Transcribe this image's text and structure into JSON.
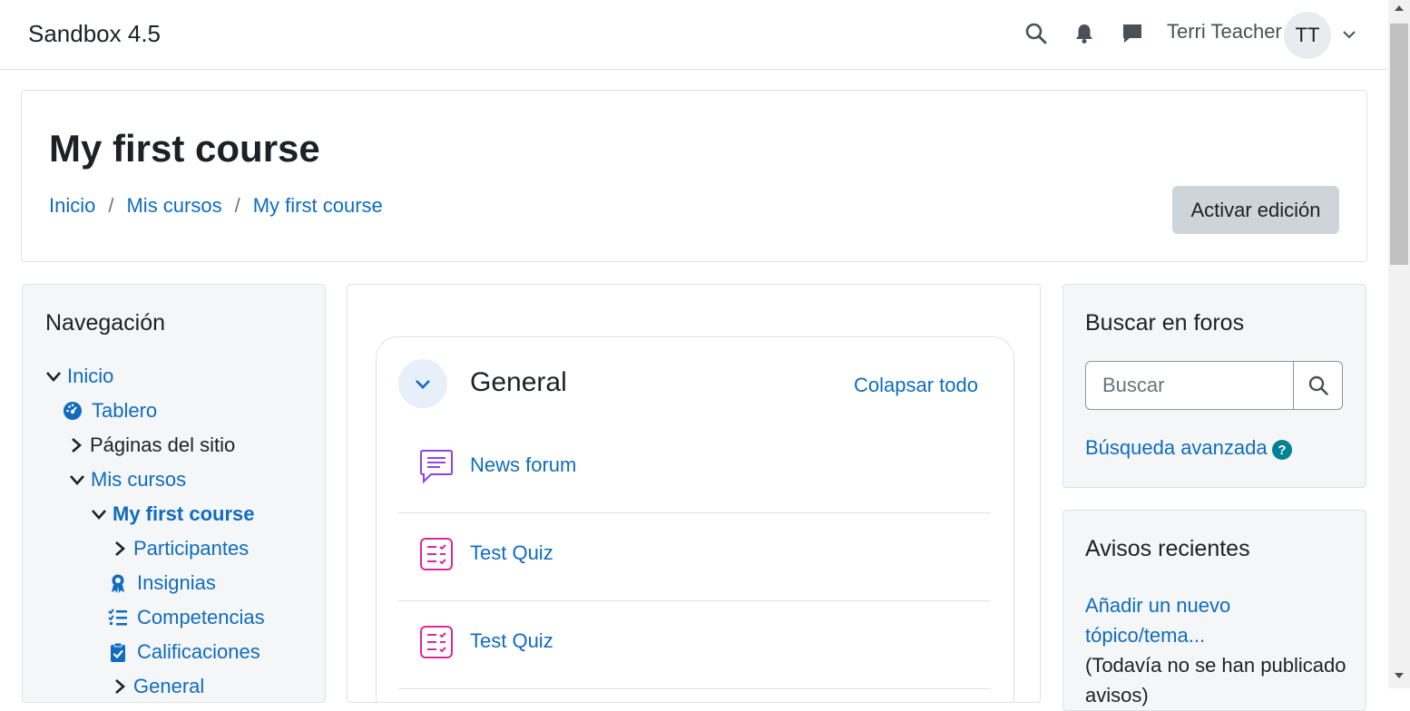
{
  "navbar": {
    "brand": "Sandbox 4.5",
    "user_name": "Terri Teacher",
    "avatar_initials": "TT"
  },
  "header": {
    "title": "My first course",
    "breadcrumb": [
      "Inicio",
      "Mis cursos",
      "My first course"
    ],
    "separator": "/",
    "edit_button": "Activar edición"
  },
  "navigation": {
    "title": "Navegación",
    "items": [
      {
        "label": "Inicio"
      },
      {
        "label": "Tablero"
      },
      {
        "label": "Páginas del sitio"
      },
      {
        "label": "Mis cursos"
      },
      {
        "label": "My first course"
      },
      {
        "label": "Participantes"
      },
      {
        "label": "Insignias"
      },
      {
        "label": "Competencias"
      },
      {
        "label": "Calificaciones"
      },
      {
        "label": "General"
      }
    ]
  },
  "course": {
    "section_name": "General",
    "collapse_all": "Colapsar todo",
    "activities": [
      {
        "name": "News forum",
        "icon": "forum-icon"
      },
      {
        "name": "Test Quiz",
        "icon": "quiz-icon"
      },
      {
        "name": "Test Quiz",
        "icon": "quiz-icon"
      }
    ]
  },
  "search_forums": {
    "title": "Buscar en foros",
    "placeholder": "Buscar",
    "advanced": "Búsqueda avanzada",
    "help": "?"
  },
  "news": {
    "title": "Avisos recientes",
    "add_link": "Añadir un nuevo tópico/tema...",
    "empty_text": "(Todavía no se han publicado avisos)"
  },
  "colors": {
    "link": "#0f6cbf",
    "forum_icon": "#8f41ee",
    "quiz_icon": "#e0269b",
    "help_icon": "#008196"
  }
}
